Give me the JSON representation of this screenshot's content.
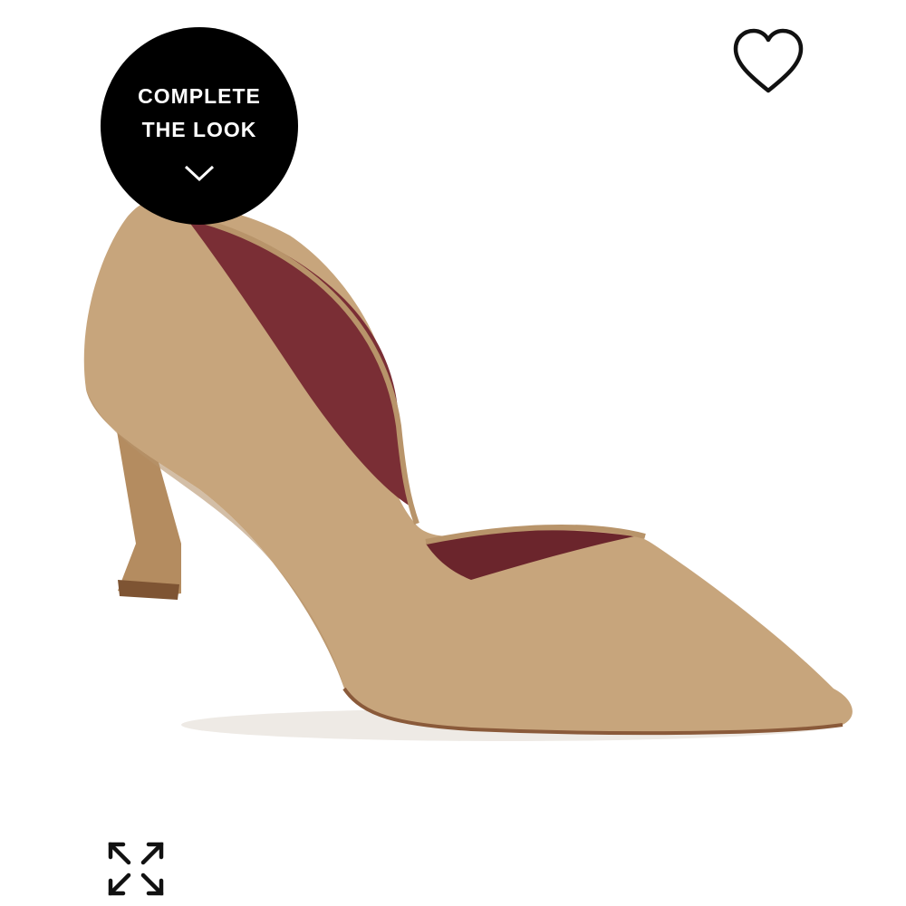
{
  "product": {
    "image_alt": "Tan suede pointed-toe d'Orsay pump with burgundy lining",
    "colors": {
      "suede": "#c7a57c",
      "suede_shadow": "#a8865e",
      "lining": "#7a2e35",
      "sole": "#8a5a3a"
    }
  },
  "complete_look": {
    "line1": "COMPLETE",
    "line2": "THE LOOK",
    "icon": "chevron-down-icon",
    "background": "#000000",
    "text_color": "#ffffff"
  },
  "wishlist": {
    "icon": "heart-outline-icon"
  },
  "expand": {
    "icon": "expand-arrows-icon"
  }
}
